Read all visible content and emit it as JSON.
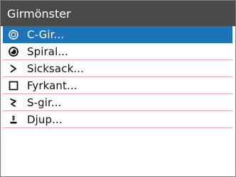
{
  "dialog": {
    "title": "Girmönster",
    "items": [
      {
        "label": "C-Gir...",
        "icon": "circle-loop-icon",
        "selected": true
      },
      {
        "label": "Spiral...",
        "icon": "spiral-icon",
        "selected": false
      },
      {
        "label": "Sicksack...",
        "icon": "zigzag-icon",
        "selected": false
      },
      {
        "label": "Fyrkant...",
        "icon": "square-icon",
        "selected": false
      },
      {
        "label": "S-gir...",
        "icon": "s-turn-icon",
        "selected": false
      },
      {
        "label": "Djup...",
        "icon": "depth-icon",
        "selected": false
      }
    ]
  },
  "colors": {
    "title_bar": "#4a4a4a",
    "selected_row": "#1e74b8",
    "separator": "#e7a7b2"
  }
}
